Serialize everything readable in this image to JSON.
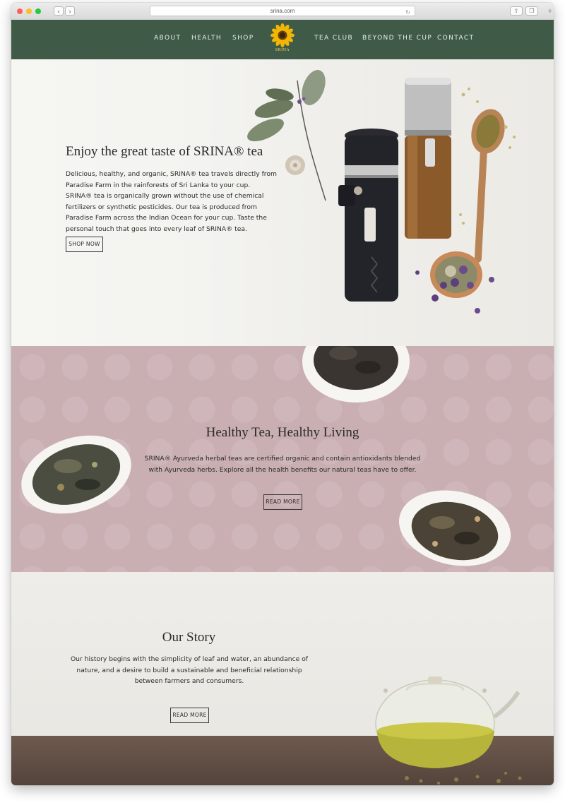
{
  "browser": {
    "url": "srina.com"
  },
  "nav": {
    "items": [
      "ABOUT",
      "HEALTH",
      "SHOP",
      "TEA CLUB",
      "BEYOND THE CUP",
      "CONTACT"
    ],
    "logo_text": "SRINA"
  },
  "hero": {
    "title": "Enjoy the great taste of SRINA® tea",
    "body": "Delicious, healthy, and organic, SRINA® tea travels directly from Paradise Farm in the rainforests of Sri Lanka to your cup. SRINA® tea is organically grown without the use of chemical fertilizers or synthetic pesticides. Our tea is produced from Paradise Farm across the Indian Ocean for your cup. Taste the personal touch that goes into every leaf of SRINA® tea.",
    "button": "SHOP NOW"
  },
  "health": {
    "title": "Healthy Tea, Healthy Living",
    "body": "SRINA® Ayurveda herbal teas are certified organic and contain antioxidants blended with Ayurveda herbs. Explore all the health benefits our natural teas have to offer.",
    "button": "READ MORE"
  },
  "story": {
    "title": "Our Story",
    "body": "Our history begins with the simplicity of leaf and water, an abundance of nature, and a desire to build a sustainable and beneficial relationship between farmers and consumers.",
    "button": "READ MORE"
  },
  "colors": {
    "header_green": "#3f5b48",
    "health_pink": "#c9aeb2",
    "logo_yellow": "#f2b705"
  }
}
